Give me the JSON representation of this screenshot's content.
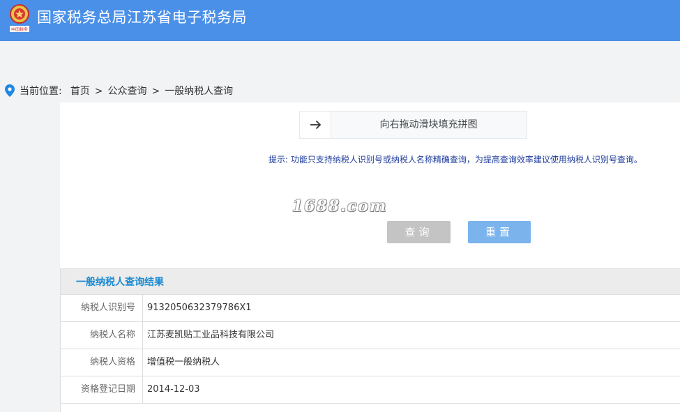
{
  "header": {
    "title": "国家税务总局江苏省电子税务局",
    "emblem_icon": "tax-emblem-icon",
    "emblem_caption": "中国税务",
    "color": "#4a90e8"
  },
  "breadcrumb": {
    "prefix": "当前位置:",
    "items": [
      "首页",
      "公众查询",
      "一般纳税人查询"
    ],
    "separator": ">"
  },
  "slider": {
    "icon": "arrow-right-icon",
    "text": "向右拖动滑块填充拼图"
  },
  "hint": "提示: 功能只支持纳税人识别号或纳税人名称精确查询，为提高查询效率建议使用纳税人识别号查询。",
  "watermark": "1688.com",
  "buttons": {
    "query": "查询",
    "reset": "重置"
  },
  "results": {
    "title": "一般纳税人查询结果",
    "rows": [
      {
        "label": "纳税人识别号",
        "value": "9132050632379786X1"
      },
      {
        "label": "纳税人名称",
        "value": "江苏麦凯贴工业品科技有限公司"
      },
      {
        "label": "纳税人资格",
        "value": "增值税一般纳税人"
      },
      {
        "label": "资格登记日期",
        "value": "2014-12-03"
      }
    ]
  }
}
